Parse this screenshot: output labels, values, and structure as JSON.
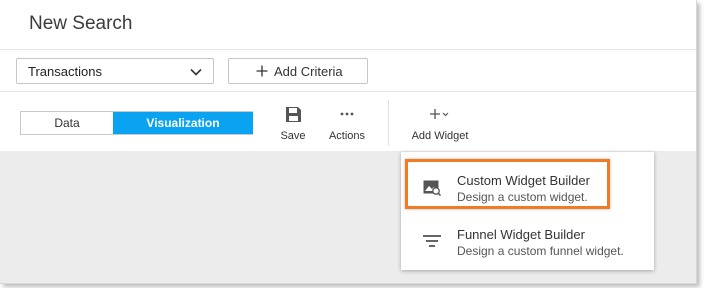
{
  "page": {
    "title": "New Search"
  },
  "query": {
    "source_select": {
      "value": "Transactions"
    },
    "add_criteria_label": "Add Criteria"
  },
  "toolbar": {
    "toggle": {
      "data_label": "Data",
      "visualization_label": "Visualization",
      "selected": "Visualization"
    },
    "save_label": "Save",
    "actions_label": "Actions",
    "add_widget_label": "Add Widget"
  },
  "widget_menu": {
    "items": [
      {
        "title": "Custom Widget Builder",
        "description": "Design a custom widget.",
        "icon": "image-search-icon",
        "highlighted": true
      },
      {
        "title": "Funnel Widget Builder",
        "description": "Design a custom funnel widget.",
        "icon": "funnel-icon",
        "highlighted": false
      }
    ]
  },
  "colors": {
    "accent": "#0aa3f1",
    "highlight": "#f27a22",
    "panel_bg": "#ececec"
  }
}
